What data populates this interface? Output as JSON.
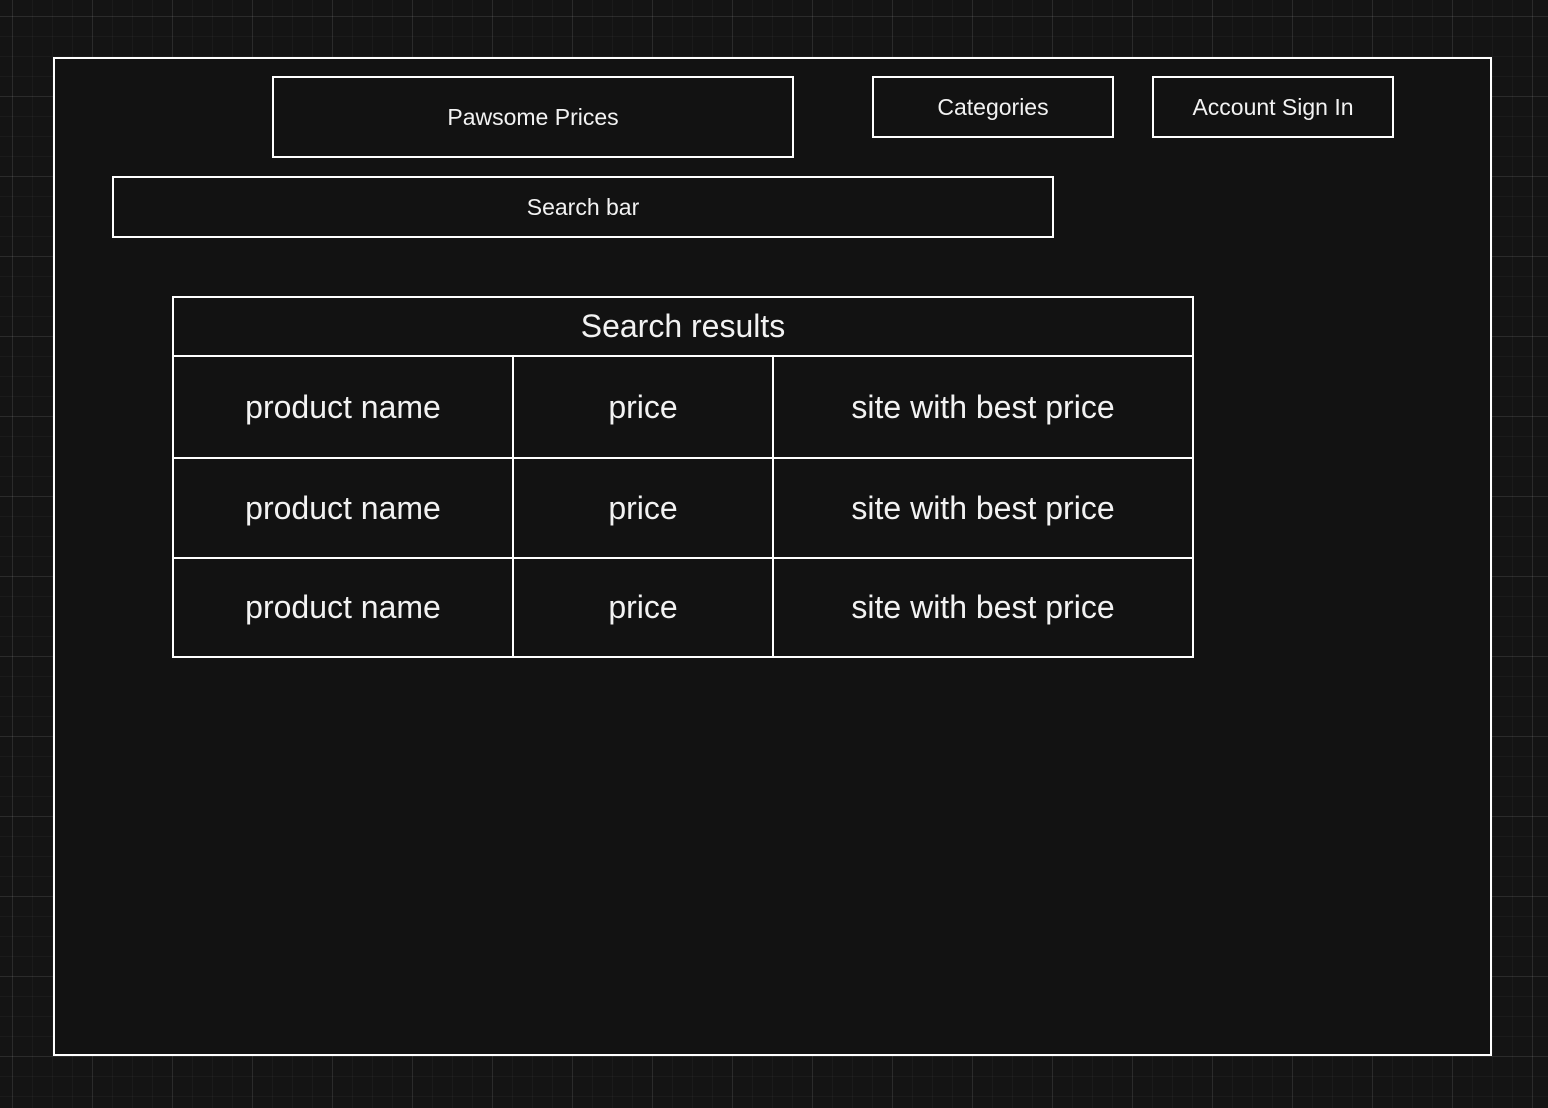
{
  "header": {
    "logo_label": "Pawsome Prices",
    "categories_label": "Categories",
    "signin_label": "Account Sign In"
  },
  "search": {
    "label": "Search bar"
  },
  "results": {
    "title": "Search results",
    "rows": [
      {
        "product": "product name",
        "price": "price",
        "site": "site with best price"
      },
      {
        "product": "product name",
        "price": "price",
        "site": "site with best price"
      },
      {
        "product": "product name",
        "price": "price",
        "site": "site with best price"
      }
    ]
  },
  "colors": {
    "background": "#141414",
    "border": "#ffffff",
    "text": "#f2f2f2"
  }
}
